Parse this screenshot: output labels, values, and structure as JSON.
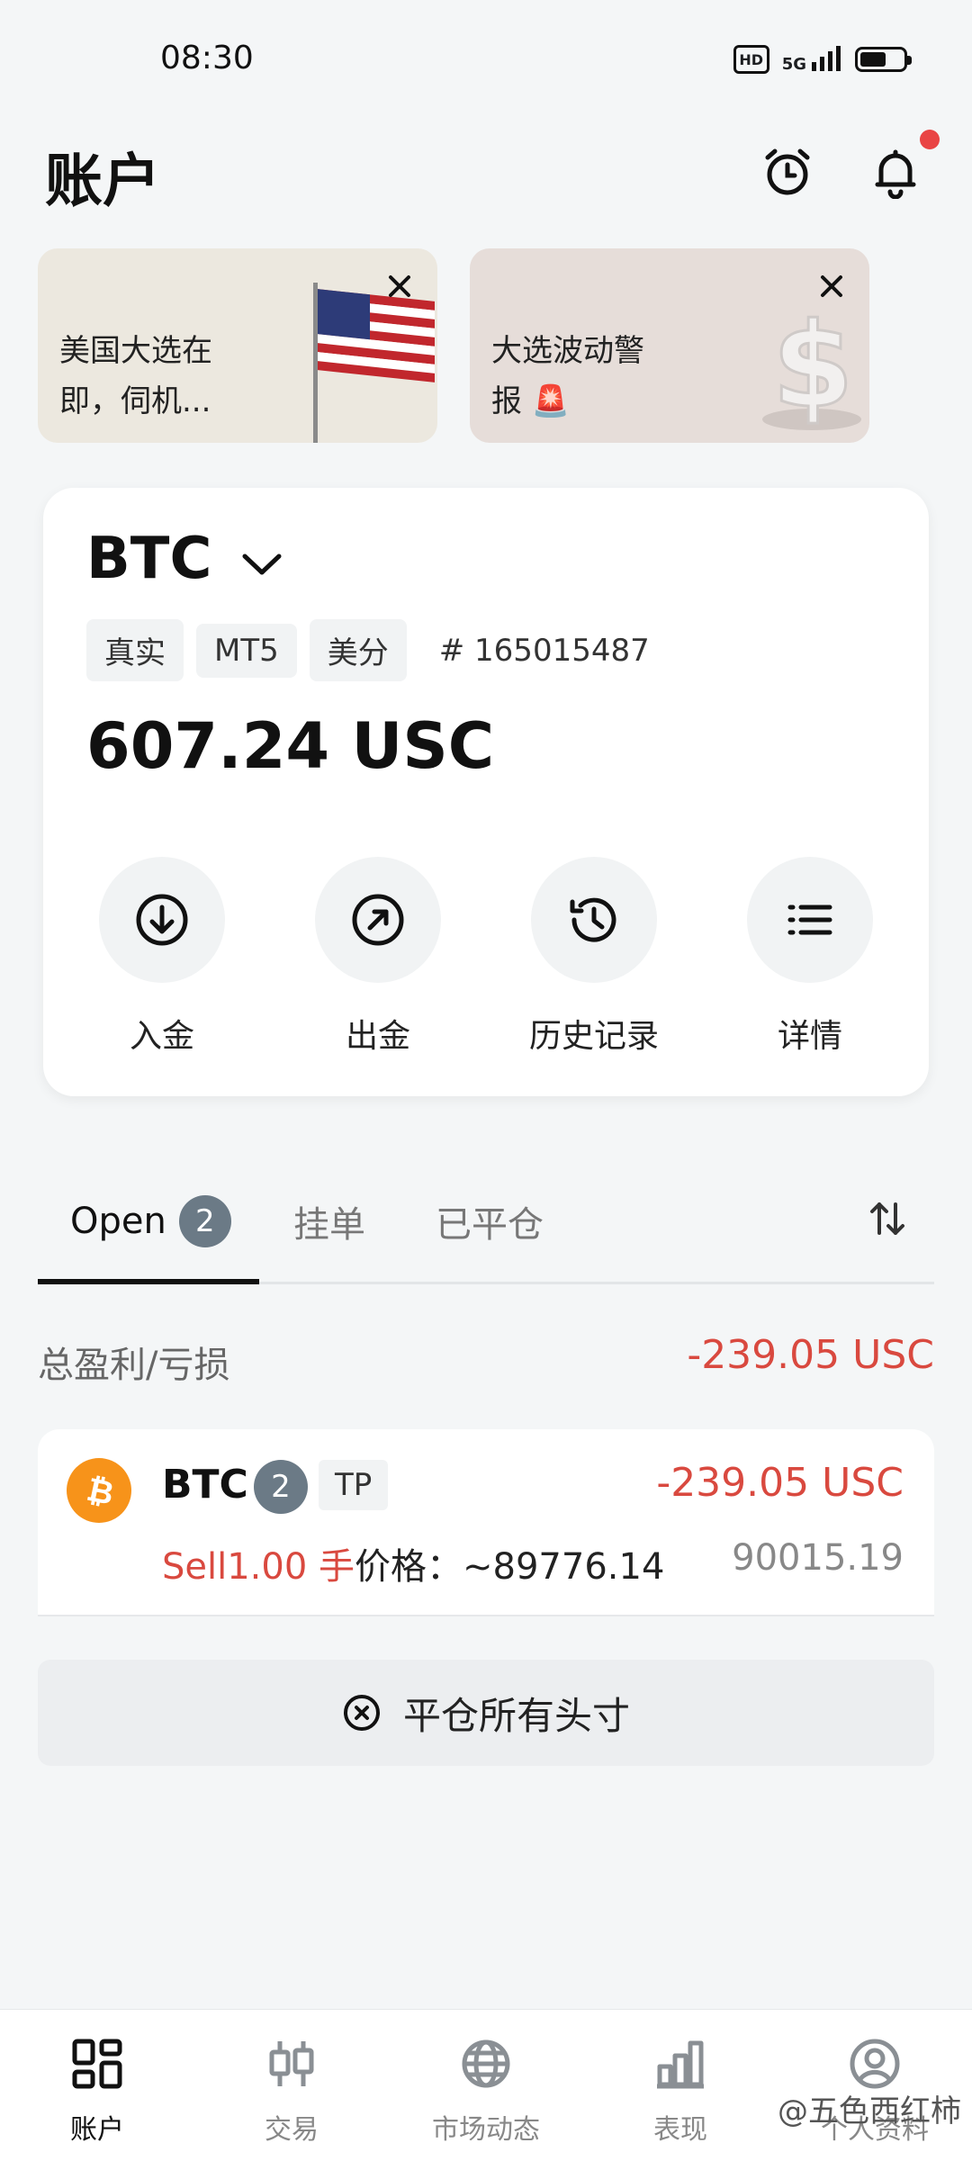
{
  "status_bar": {
    "time": "08:30",
    "hd": "HD",
    "network": "5G",
    "battery_level": 0.6
  },
  "header": {
    "title": "账户"
  },
  "promos": [
    {
      "text_line1": "美国大选在",
      "text_line2": "即，伺机..."
    },
    {
      "text_line1": "大选波动警",
      "text_line2": "报 🚨"
    }
  ],
  "account": {
    "name": "BTC",
    "tags": [
      "真实",
      "MT5",
      "美分"
    ],
    "number": "# 165015487",
    "balance": "607.24 USC",
    "actions": [
      "入金",
      "出金",
      "历史记录",
      "详情"
    ]
  },
  "tabs": {
    "open_label": "Open",
    "open_count": "2",
    "pending_label": "挂单",
    "closed_label": "已平仓"
  },
  "summary": {
    "label": "总盈利/亏损",
    "value": "-239.05 USC"
  },
  "position": {
    "symbol": "BTC",
    "count": "2",
    "tag": "TP",
    "pnl": "-239.05 USC",
    "side_volume": "Sell1.00 手",
    "price_text": "价格：~89776.14",
    "current_price": "90015.19"
  },
  "close_all": {
    "label": "平仓所有头寸"
  },
  "bottom_nav": {
    "items": [
      "账户",
      "交易",
      "市场动态",
      "表现",
      "个人资料"
    ]
  },
  "watermark": "@五色西红柿",
  "colors": {
    "loss": "#d9493f",
    "btc": "#f7931a",
    "badge": "#6b7a86",
    "notification": "#e94444"
  }
}
